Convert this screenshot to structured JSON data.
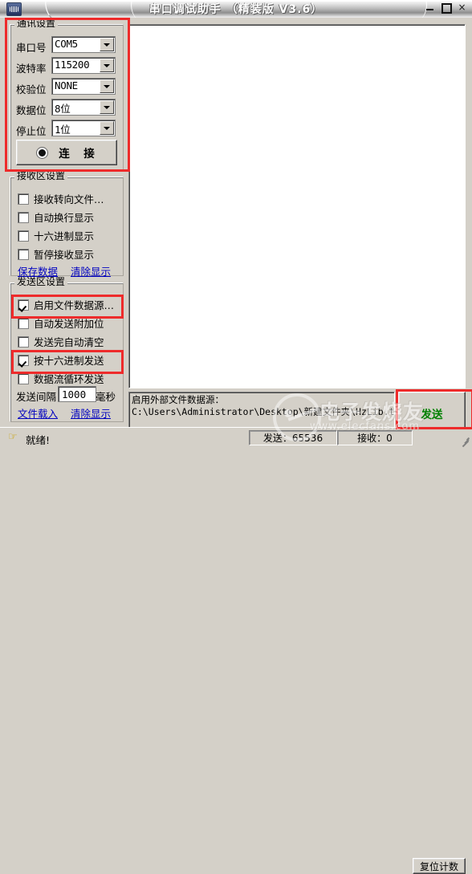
{
  "window": {
    "title": "串口调试助手 （精装版 V3.6）",
    "app_icon": "serial-app-icon",
    "minimize": "–",
    "maximize": "□",
    "close": "×"
  },
  "comm_settings": {
    "legend": "通讯设置",
    "fields": [
      {
        "label": "串口号",
        "value": "COM5"
      },
      {
        "label": "波特率",
        "value": "115200"
      },
      {
        "label": "校验位",
        "value": "NONE"
      },
      {
        "label": "数据位",
        "value": "8位"
      },
      {
        "label": "停止位",
        "value": "1位"
      }
    ],
    "connect_button": "连　接"
  },
  "recv_settings": {
    "legend": "接收区设置",
    "options": [
      {
        "label": "接收转向文件…",
        "checked": false
      },
      {
        "label": "自动换行显示",
        "checked": false
      },
      {
        "label": "十六进制显示",
        "checked": false
      },
      {
        "label": "暂停接收显示",
        "checked": false
      }
    ],
    "save_link": "保存数据",
    "clear_link": "清除显示"
  },
  "send_settings": {
    "legend": "发送区设置",
    "options": [
      {
        "label": "启用文件数据源…",
        "checked": true
      },
      {
        "label": "自动发送附加位",
        "checked": false
      },
      {
        "label": "发送完自动清空",
        "checked": false
      },
      {
        "label": "按十六进制发送",
        "checked": true
      },
      {
        "label": "数据流循环发送",
        "checked": false
      }
    ],
    "interval_label": "发送间隔",
    "interval_value": "1000",
    "interval_unit": "毫秒",
    "load_file_link": "文件载入",
    "clear_link": "清除显示"
  },
  "receive_area": {
    "text": ""
  },
  "send_area": {
    "line1": "启用外部文件数据源：",
    "line2": "C:\\Users\\Administrator\\Desktop\\新建文件夹\\HzLib.txt ..."
  },
  "send_button": {
    "label": "发送",
    "color": "#008000"
  },
  "status_bar": {
    "icon": "hand-pointer-icon",
    "ready": "就绪!",
    "sent": "发送：65536",
    "received": "接收：0",
    "reset_button": "复位计数"
  },
  "watermark": {
    "text": "电子发烧友",
    "sub": "www.elecfans.com"
  },
  "annotations": {
    "color": "#ee2b2b",
    "count": 4
  }
}
